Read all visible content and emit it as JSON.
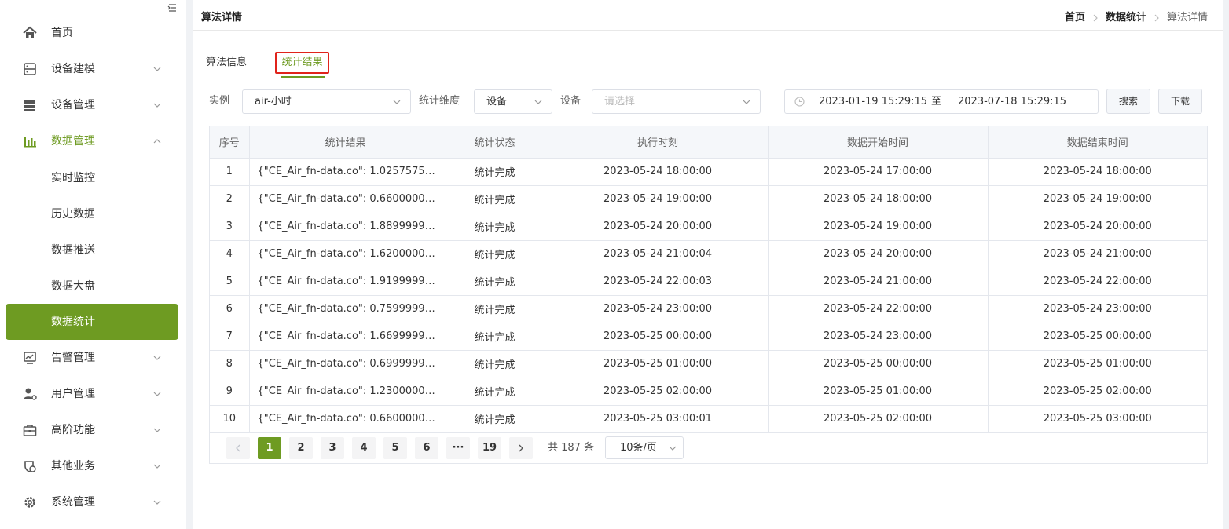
{
  "sidebar": {
    "items": [
      {
        "label": "首页",
        "icon": "home-icon"
      },
      {
        "label": "设备建模",
        "icon": "server-icon"
      },
      {
        "label": "设备管理",
        "icon": "device-icon"
      },
      {
        "label": "数据管理",
        "icon": "bar-chart-icon"
      },
      {
        "label": "实时监控"
      },
      {
        "label": "历史数据"
      },
      {
        "label": "数据推送"
      },
      {
        "label": "数据大盘"
      },
      {
        "label": "数据统计"
      },
      {
        "label": "告警管理",
        "icon": "monitor-chart-icon"
      },
      {
        "label": "用户管理",
        "icon": "user-gear-icon"
      },
      {
        "label": "高阶功能",
        "icon": "briefcase-icon"
      },
      {
        "label": "其他业务",
        "icon": "shield-icon"
      },
      {
        "label": "系统管理",
        "icon": "gear-icon"
      }
    ],
    "accent_color": "#6e9b22"
  },
  "header": {
    "title": "算法详情",
    "breadcrumb": [
      "首页",
      "数据统计",
      "算法详情"
    ]
  },
  "tabs": [
    {
      "label": "算法信息"
    },
    {
      "label": "统计结果",
      "active": true
    }
  ],
  "filters": {
    "instance_label": "实例",
    "instance_value": "air-小时",
    "dimension_label": "统计维度",
    "dimension_value": "设备",
    "device_label": "设备",
    "device_placeholder": "请选择",
    "date_start": "2023-01-19 15:29:15",
    "date_to": "至",
    "date_end": "2023-07-18 15:29:15",
    "search_label": "搜索",
    "download_label": "下载"
  },
  "table": {
    "columns": [
      "序号",
      "统计结果",
      "统计状态",
      "执行时刻",
      "数据开始时间",
      "数据结束时间"
    ],
    "rows": [
      [
        "1",
        "{\"CE_Air_fn-data.co\": 1.0257575…",
        "统计完成",
        "2023-05-24 18:00:00",
        "2023-05-24 17:00:00",
        "2023-05-24 18:00:00"
      ],
      [
        "2",
        "{\"CE_Air_fn-data.co\": 0.6600000…",
        "统计完成",
        "2023-05-24 19:00:00",
        "2023-05-24 18:00:00",
        "2023-05-24 19:00:00"
      ],
      [
        "3",
        "{\"CE_Air_fn-data.co\": 1.8899999…",
        "统计完成",
        "2023-05-24 20:00:00",
        "2023-05-24 19:00:00",
        "2023-05-24 20:00:00"
      ],
      [
        "4",
        "{\"CE_Air_fn-data.co\": 1.6200000…",
        "统计完成",
        "2023-05-24 21:00:04",
        "2023-05-24 20:00:00",
        "2023-05-24 21:00:00"
      ],
      [
        "5",
        "{\"CE_Air_fn-data.co\": 1.9199999…",
        "统计完成",
        "2023-05-24 22:00:03",
        "2023-05-24 21:00:00",
        "2023-05-24 22:00:00"
      ],
      [
        "6",
        "{\"CE_Air_fn-data.co\": 0.7599999…",
        "统计完成",
        "2023-05-24 23:00:00",
        "2023-05-24 22:00:00",
        "2023-05-24 23:00:00"
      ],
      [
        "7",
        "{\"CE_Air_fn-data.co\": 1.6699999…",
        "统计完成",
        "2023-05-25 00:00:00",
        "2023-05-24 23:00:00",
        "2023-05-25 00:00:00"
      ],
      [
        "8",
        "{\"CE_Air_fn-data.co\": 0.6999999…",
        "统计完成",
        "2023-05-25 01:00:00",
        "2023-05-25 00:00:00",
        "2023-05-25 01:00:00"
      ],
      [
        "9",
        "{\"CE_Air_fn-data.co\": 1.2300000…",
        "统计完成",
        "2023-05-25 02:00:00",
        "2023-05-25 01:00:00",
        "2023-05-25 02:00:00"
      ],
      [
        "10",
        "{\"CE_Air_fn-data.co\": 0.6600000…",
        "统计完成",
        "2023-05-25 03:00:01",
        "2023-05-25 02:00:00",
        "2023-05-25 03:00:00"
      ]
    ]
  },
  "pagination": {
    "pages": [
      "1",
      "2",
      "3",
      "4",
      "5",
      "6",
      "···",
      "19"
    ],
    "current": "1",
    "total_text": "共 187 条",
    "page_size": "10条/页"
  }
}
